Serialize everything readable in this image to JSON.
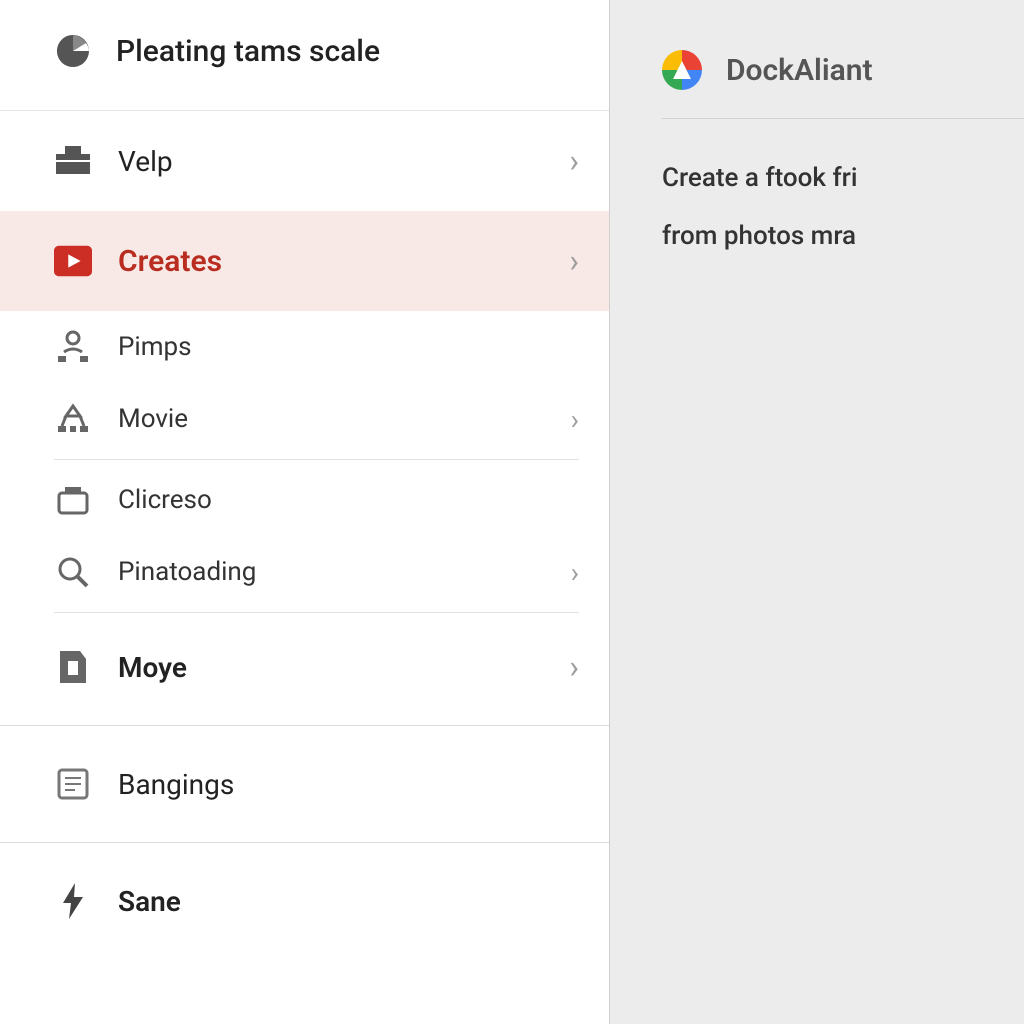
{
  "sidebar": {
    "header": {
      "label": "Pleating tams scale"
    },
    "items": [
      {
        "id": "velp",
        "label": "Velp",
        "icon": "briefcase-icon",
        "chevron": true
      },
      {
        "id": "creates",
        "label": "Creates",
        "icon": "play-icon",
        "chevron": true,
        "active": true
      },
      {
        "id": "pimps",
        "label": "Pimps",
        "icon": "person-node-icon",
        "chevron": false
      },
      {
        "id": "movie",
        "label": "Movie",
        "icon": "node-tree-icon",
        "chevron": true
      },
      {
        "id": "clicreso",
        "label": "Clicreso",
        "icon": "box-icon",
        "chevron": false
      },
      {
        "id": "pinatoading",
        "label": "Pinatoading",
        "icon": "search-icon",
        "chevron": true
      },
      {
        "id": "moye",
        "label": "Moye",
        "icon": "document-icon",
        "chevron": true,
        "bold": true
      },
      {
        "id": "bangings",
        "label": "Bangings",
        "icon": "list-icon",
        "chevron": false
      },
      {
        "id": "sane",
        "label": "Sane",
        "icon": "bolt-icon",
        "chevron": false,
        "bold": true
      }
    ]
  },
  "content": {
    "title": "DockAliant",
    "line1": "Create a ftook fri",
    "line2": "from photos mra"
  }
}
